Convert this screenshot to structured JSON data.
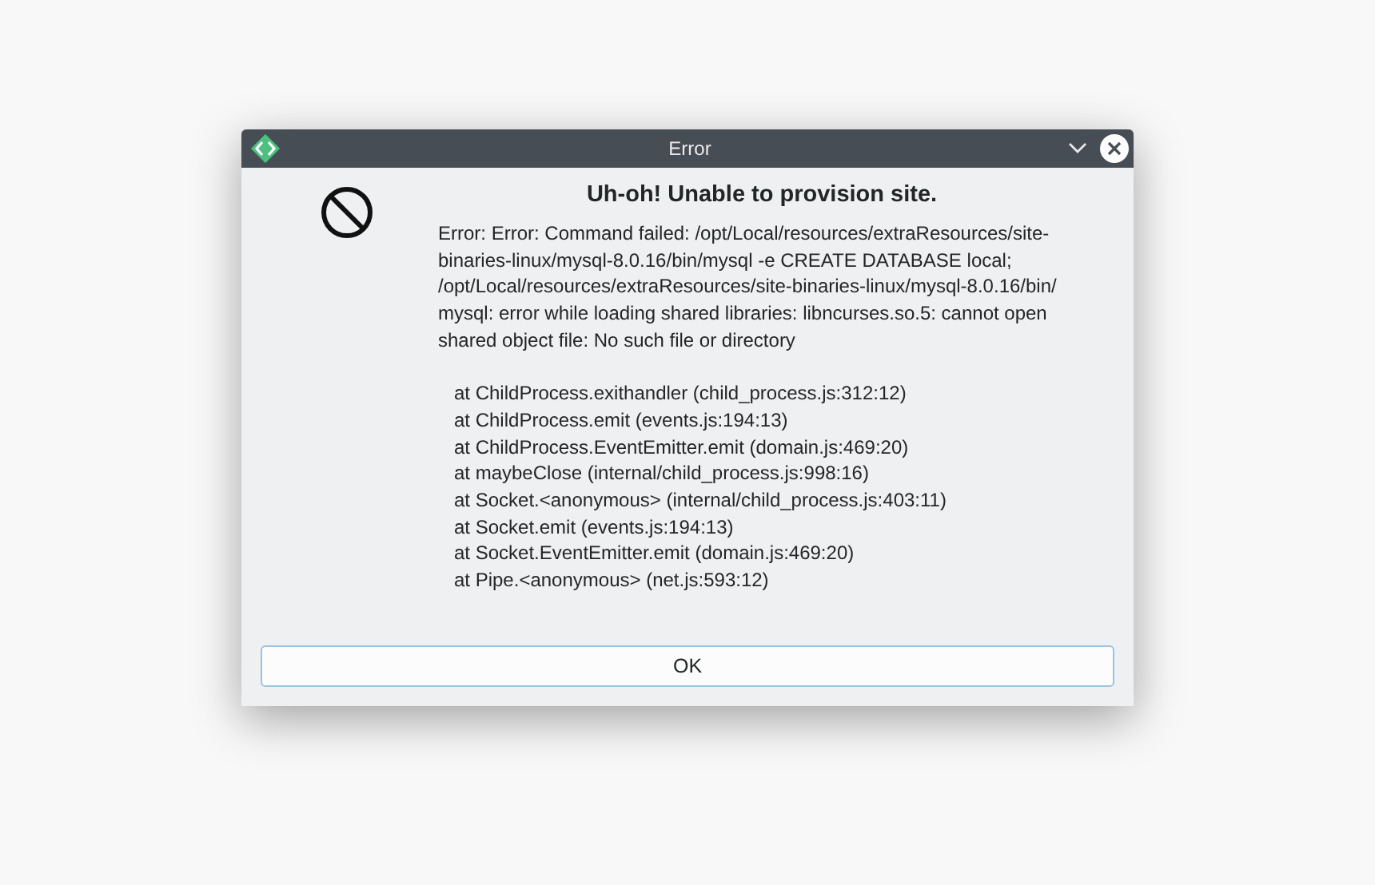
{
  "window": {
    "title": "Error"
  },
  "heading": "Uh-oh! Unable to provision site.",
  "message_lines": [
    "Error: Error: Command failed: /opt/Local/resources/extraResources/site-",
    "binaries-linux/mysql-8.0.16/bin/mysql -e CREATE DATABASE local;",
    "/opt/Local/resources/extraResources/site-binaries-linux/mysql-8.0.16/bin/",
    "mysql: error while loading shared libraries: libncurses.so.5: cannot open",
    "shared object file: No such file or directory"
  ],
  "stack_lines": [
    "at ChildProcess.exithandler (child_process.js:312:12)",
    "at ChildProcess.emit (events.js:194:13)",
    "at ChildProcess.EventEmitter.emit (domain.js:469:20)",
    "at maybeClose (internal/child_process.js:998:16)",
    "at Socket.<anonymous> (internal/child_process.js:403:11)",
    "at Socket.emit (events.js:194:13)",
    "at Socket.EventEmitter.emit (domain.js:469:20)",
    "at Pipe.<anonymous> (net.js:593:12)"
  ],
  "buttons": [
    "OK"
  ]
}
